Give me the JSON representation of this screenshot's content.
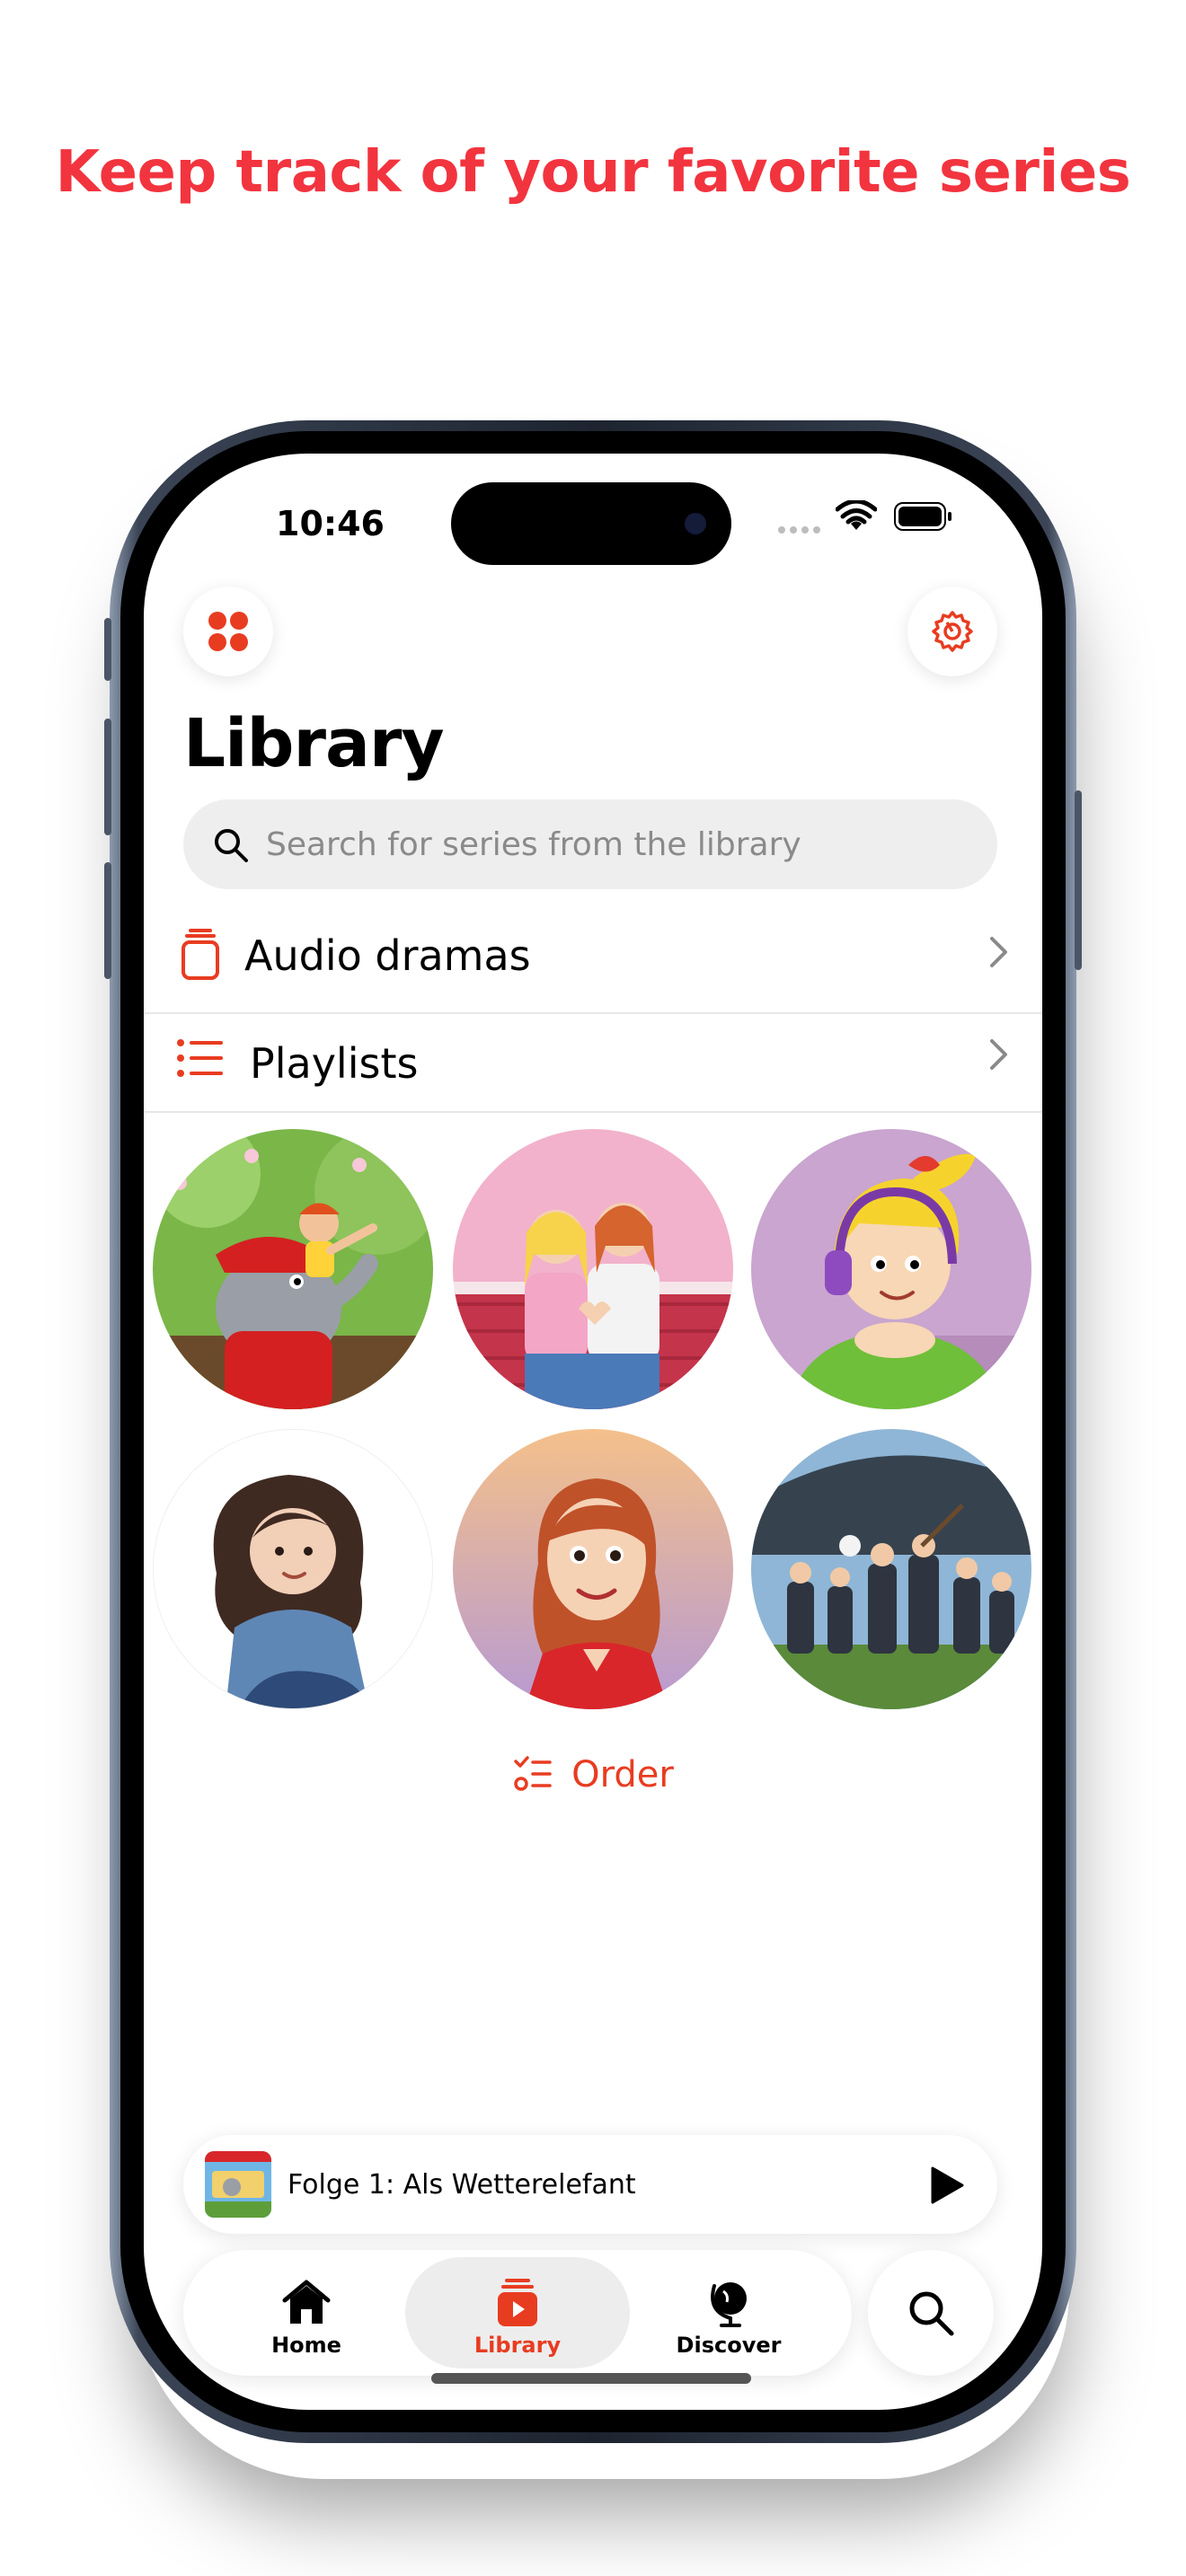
{
  "headline": "Keep track of your favorite series",
  "status_bar": {
    "time": "10:46"
  },
  "header": {
    "apps_icon": "apps-grid-icon",
    "settings_icon": "settings-gear-icon"
  },
  "page_title": "Library",
  "search": {
    "placeholder": "Search for series from the library"
  },
  "rows": [
    {
      "label": "Audio dramas",
      "icon": "audio-dramas-icon"
    },
    {
      "label": "Playlists",
      "icon": "playlists-icon"
    }
  ],
  "covers": [
    "series-cover-1",
    "series-cover-2",
    "series-cover-3",
    "series-cover-4",
    "series-cover-5",
    "series-cover-6"
  ],
  "order": {
    "label": "Order"
  },
  "mini_player": {
    "title": "Folge 1: Als Wetterelefant"
  },
  "tabs": [
    {
      "label": "Home",
      "active": false
    },
    {
      "label": "Library",
      "active": true
    },
    {
      "label": "Discover",
      "active": false
    }
  ],
  "colors": {
    "headline": "#f2343f",
    "accent": "#e83c21"
  }
}
